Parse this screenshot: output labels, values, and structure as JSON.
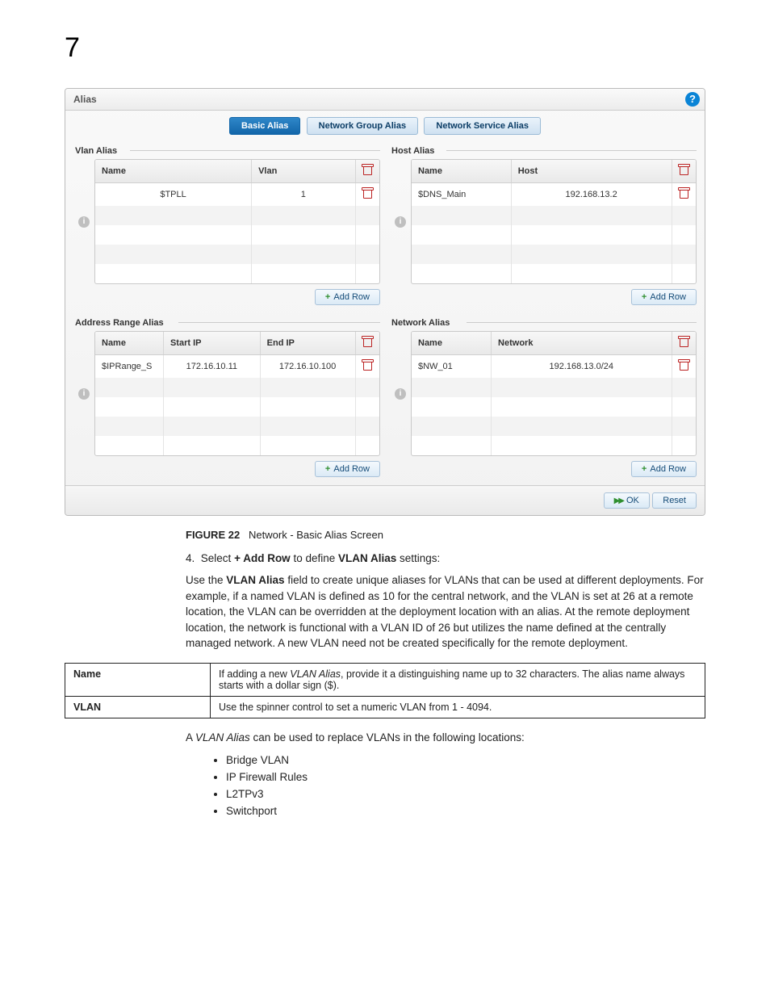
{
  "chapter_number": "7",
  "panel": {
    "title": "Alias",
    "help_glyph": "?",
    "tabs": {
      "basic": "Basic Alias",
      "group": "Network Group Alias",
      "service": "Network Service Alias"
    },
    "add_row_label": "Add Row",
    "ok_label": "OK",
    "reset_label": "Reset",
    "vlan_alias": {
      "label": "Vlan Alias",
      "cols": {
        "name": "Name",
        "vlan": "Vlan"
      },
      "rows": [
        {
          "name": "$TPLL",
          "vlan": "1"
        }
      ]
    },
    "host_alias": {
      "label": "Host Alias",
      "cols": {
        "name": "Name",
        "host": "Host"
      },
      "rows": [
        {
          "name": "$DNS_Main",
          "host": "192.168.13.2"
        }
      ]
    },
    "addr_alias": {
      "label": "Address Range Alias",
      "cols": {
        "name": "Name",
        "start": "Start IP",
        "end": "End IP"
      },
      "rows": [
        {
          "name": "$IPRange_S",
          "start": "172.16.10.11",
          "end": "172.16.10.100"
        }
      ]
    },
    "net_alias": {
      "label": "Network Alias",
      "cols": {
        "name": "Name",
        "network": "Network"
      },
      "rows": [
        {
          "name": "$NW_01",
          "network": "192.168.13.0/24"
        }
      ]
    }
  },
  "caption": {
    "label": "FIGURE 22",
    "text": "Network - Basic Alias Screen"
  },
  "step4": {
    "num": "4.",
    "pre": "Select ",
    "bold1": "+ Add Row",
    "mid": " to define ",
    "bold2": "VLAN Alias",
    "post": " settings:"
  },
  "para1": {
    "pre": "Use the ",
    "bold": "VLAN Alias",
    "post": " field to create unique aliases for VLANs that can be used at different deployments. For example, if a named VLAN is defined as 10 for the central network, and the VLAN is set at 26 at a remote location, the VLAN can be overridden at the deployment location with an alias. At the remote deployment location, the network is functional with a VLAN ID of 26 but utilizes the name defined at the centrally managed network. A new VLAN need not be created specifically for the remote deployment."
  },
  "def_table": {
    "name_key": "Name",
    "name_val_pre": "If adding a new ",
    "name_val_i": "VLAN Alias",
    "name_val_post": ", provide it a distinguishing name up to 32 characters. The alias name always starts with a dollar sign ($).",
    "vlan_key": "VLAN",
    "vlan_val": "Use the spinner control to set a numeric VLAN from 1 - 4094."
  },
  "post_para": {
    "pre": "A ",
    "i": "VLAN Alias",
    "post": " can be used to replace VLANs in the following locations:"
  },
  "locations": [
    "Bridge VLAN",
    "IP Firewall Rules",
    "L2TPv3",
    "Switchport"
  ]
}
